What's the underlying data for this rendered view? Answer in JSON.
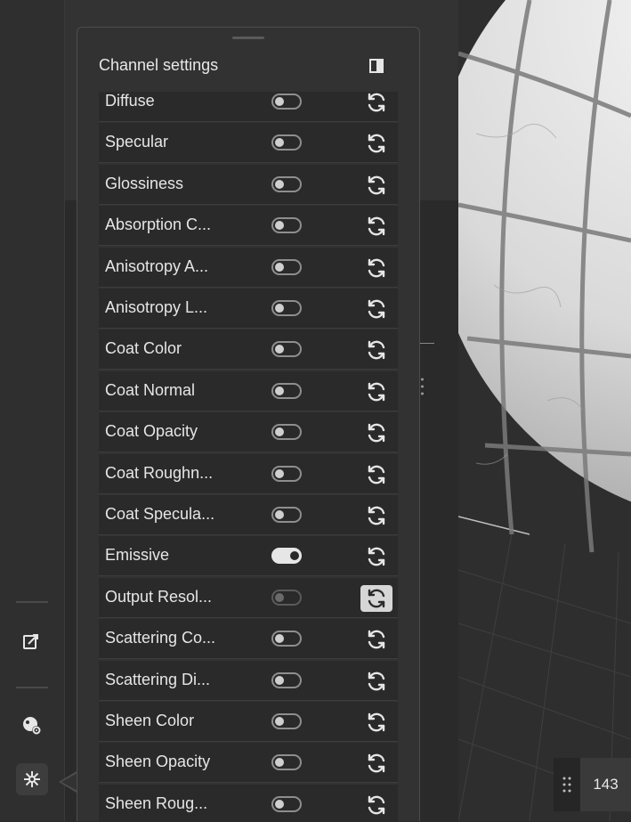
{
  "panel": {
    "title": "Channel settings",
    "channels": [
      {
        "label": "Diffuse",
        "toggle": "off"
      },
      {
        "label": "Specular",
        "toggle": "off"
      },
      {
        "label": "Glossiness",
        "toggle": "off"
      },
      {
        "label": "Absorption C...",
        "toggle": "off"
      },
      {
        "label": "Anisotropy A...",
        "toggle": "off"
      },
      {
        "label": "Anisotropy L...",
        "toggle": "off"
      },
      {
        "label": "Coat Color",
        "toggle": "off"
      },
      {
        "label": "Coat Normal",
        "toggle": "off"
      },
      {
        "label": "Coat Opacity",
        "toggle": "off"
      },
      {
        "label": "Coat Roughn...",
        "toggle": "off"
      },
      {
        "label": "Coat Specula...",
        "toggle": "off"
      },
      {
        "label": "Emissive",
        "toggle": "on"
      },
      {
        "label": "Output Resol...",
        "toggle": "disabled",
        "refresh_active": true
      },
      {
        "label": "Scattering Co...",
        "toggle": "off"
      },
      {
        "label": "Scattering Di...",
        "toggle": "off"
      },
      {
        "label": "Sheen Color",
        "toggle": "off"
      },
      {
        "label": "Sheen Opacity",
        "toggle": "off"
      },
      {
        "label": "Sheen Roug...",
        "toggle": "off"
      }
    ]
  },
  "viewport": {
    "counter": "143"
  },
  "icons": {
    "panel_toggle": "panel-layout-icon",
    "rail_1": "export-image-icon",
    "rail_2": "material-settings-icon",
    "rail_3": "channels-node-icon",
    "row_action": "refresh-icon"
  },
  "colors": {
    "background": "#2b2b2b",
    "panel": "#323232",
    "row": "#2a2a2a",
    "text": "#e6e6e6",
    "active_refresh": "#d6d6d6"
  }
}
